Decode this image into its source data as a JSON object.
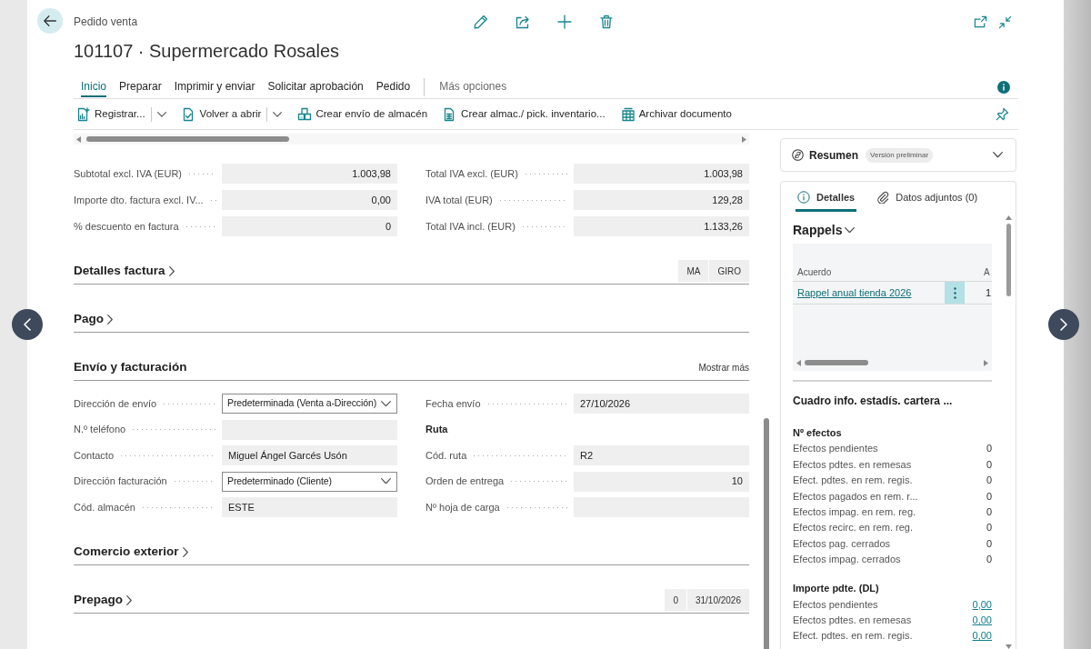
{
  "header": {
    "caption": "Pedido venta",
    "title": "101107 · Supermercado Rosales"
  },
  "action_tabs": [
    {
      "label": "Inicio",
      "selected": true
    },
    {
      "label": "Preparar",
      "selected": false
    },
    {
      "label": "Imprimir y enviar",
      "selected": false
    },
    {
      "label": "Solicitar aprobación",
      "selected": false
    },
    {
      "label": "Pedido",
      "selected": false
    }
  ],
  "more_options": "Más opciones",
  "toolbar": [
    {
      "label": "Registrar...",
      "split": true
    },
    {
      "label": "Volver a abrir",
      "split": true
    },
    {
      "label": "Crear envío de almacén",
      "split": false
    },
    {
      "label": "Crear almac./ pick. inventario...",
      "split": false
    },
    {
      "label": "Archivar documento",
      "split": false
    }
  ],
  "totals": {
    "left": [
      {
        "kind": "number",
        "label": "Subtotal excl. IVA (EUR)",
        "value": "1.003,98"
      },
      {
        "kind": "number",
        "label": "Importe dto. factura excl. IV...",
        "value": "0,00"
      },
      {
        "kind": "number",
        "label": "% descuento en factura",
        "value": "0"
      }
    ],
    "right": [
      {
        "kind": "number",
        "label": "Total IVA excl. (EUR)",
        "value": "1.003,98"
      },
      {
        "kind": "number",
        "label": "IVA total (EUR)",
        "value": "129,28"
      },
      {
        "kind": "number",
        "label": "Total IVA incl. (EUR)",
        "value": "1.133,26"
      }
    ]
  },
  "sections": [
    {
      "title": "Detalles factura",
      "expanded": false,
      "summary_values": [
        "MA",
        "GIRO"
      ]
    },
    {
      "title": "Pago",
      "expanded": false
    },
    {
      "title": "Envío y facturación",
      "expanded": true,
      "show_more": "Mostrar más",
      "fields_left": [
        {
          "kind": "dropdown",
          "label": "Dirección de envío",
          "value": "Predeterminada (Venta a-Dirección)"
        },
        {
          "kind": "text",
          "label": "N.º teléfono"
        },
        {
          "kind": "text",
          "label": "Contacto",
          "value": "Miguel Ángel Garcés Usón"
        },
        {
          "kind": "dropdown",
          "label": "Dirección facturación",
          "value": "Predeterminado (Cliente)"
        },
        {
          "kind": "text",
          "label": "Cód. almacén",
          "value": "ESTE"
        }
      ],
      "fields_right": [
        {
          "kind": "text",
          "label": "Fecha envío",
          "value": "27/10/2026"
        },
        {
          "kind": "heading",
          "label": "Ruta"
        },
        {
          "kind": "text",
          "label": "Cód. ruta",
          "value": "R2"
        },
        {
          "kind": "number",
          "label": "Orden de entrega",
          "value": "10"
        },
        {
          "kind": "text",
          "label": "Nº hoja de carga"
        }
      ]
    },
    {
      "title": "Comercio exterior",
      "expanded": false
    },
    {
      "title": "Prepago",
      "expanded": false,
      "summary_values": [
        "0",
        "31/10/2026"
      ]
    }
  ],
  "factbox": {
    "summary": {
      "title": "Resumen",
      "badge": "Versión preliminar",
      "expanded": false
    },
    "tabs": [
      {
        "label": "Detalles",
        "selected": true
      },
      {
        "label": "Datos adjuntos (0)",
        "selected": false
      }
    ],
    "rappels": {
      "title": "Rappels",
      "columns": [
        "Acuerdo",
        "A"
      ],
      "rows": [
        {
          "cells": [
            "Rappel anual tienda 2026",
            "1"
          ]
        }
      ]
    },
    "stats": {
      "title": "Cuadro info. estadís. cartera ...",
      "groups": [
        {
          "title": "Nº efectos",
          "kind": "count",
          "rows": [
            {
              "label": "Efectos pendientes",
              "value": "0"
            },
            {
              "label": "Efectos pdtes. en remesas",
              "value": "0"
            },
            {
              "label": "Efect. pdtes. en rem. regis.",
              "value": "0"
            },
            {
              "label": "Efectos pagados en rem. r...",
              "value": "0"
            },
            {
              "label": "Efectos impag. en rem. reg.",
              "value": "0"
            },
            {
              "label": "Efectos recirc. en rem. reg.",
              "value": "0"
            },
            {
              "label": "Efectos pag. cerrados",
              "value": "0"
            },
            {
              "label": "Efectos impag. cerrados",
              "value": "0"
            }
          ]
        },
        {
          "title": "Importe pdte. (DL)",
          "kind": "amount",
          "rows": [
            {
              "label": "Efectos pendientes",
              "value": "0,00"
            },
            {
              "label": "Efectos pdtes. en remesas",
              "value": "0,00"
            },
            {
              "label": "Efect. pdtes. en rem. regis.",
              "value": "0,00"
            }
          ]
        }
      ]
    }
  }
}
